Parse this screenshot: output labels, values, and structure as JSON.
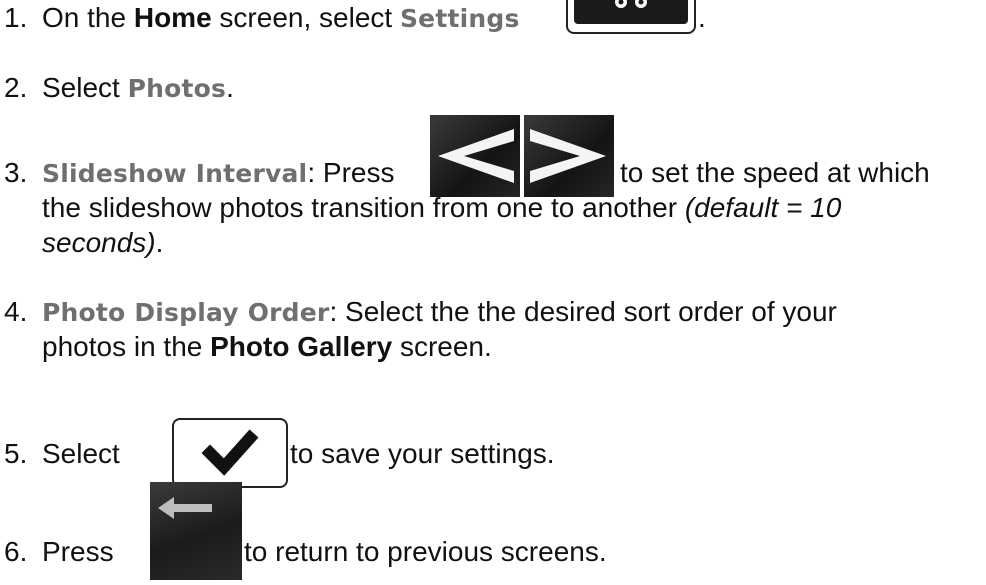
{
  "steps": [
    {
      "num": "1.",
      "a": "On the ",
      "b": "Home",
      "c": " screen, select ",
      "term": "Settings",
      "end": "."
    },
    {
      "num": "2.",
      "a": "Select ",
      "term": "Photos",
      "end": "."
    },
    {
      "num": "3.",
      "term": "Slideshow Interval",
      "a": ": Press ",
      "b": "to set the speed at which",
      "line2": "the slideshow photos transition from one to another ",
      "ital1": "(default = 10",
      "ital2": "seconds)",
      "end": "."
    },
    {
      "num": "4.",
      "term": "Photo Display Order",
      "a": ": Select the the desired sort order of your",
      "line2a": "photos in the ",
      "bold": "Photo Gallery",
      "line2b": " screen."
    },
    {
      "num": "5.",
      "a": "Select ",
      "b": " to save your settings."
    },
    {
      "num": "6.",
      "a": "Press ",
      "b": " to return to previous screens."
    }
  ],
  "icons": {
    "settings": "gear-icon",
    "prev": "left-arrow-icon",
    "next": "right-arrow-icon",
    "save": "checkmark-icon",
    "back": "back-arrow-icon"
  }
}
